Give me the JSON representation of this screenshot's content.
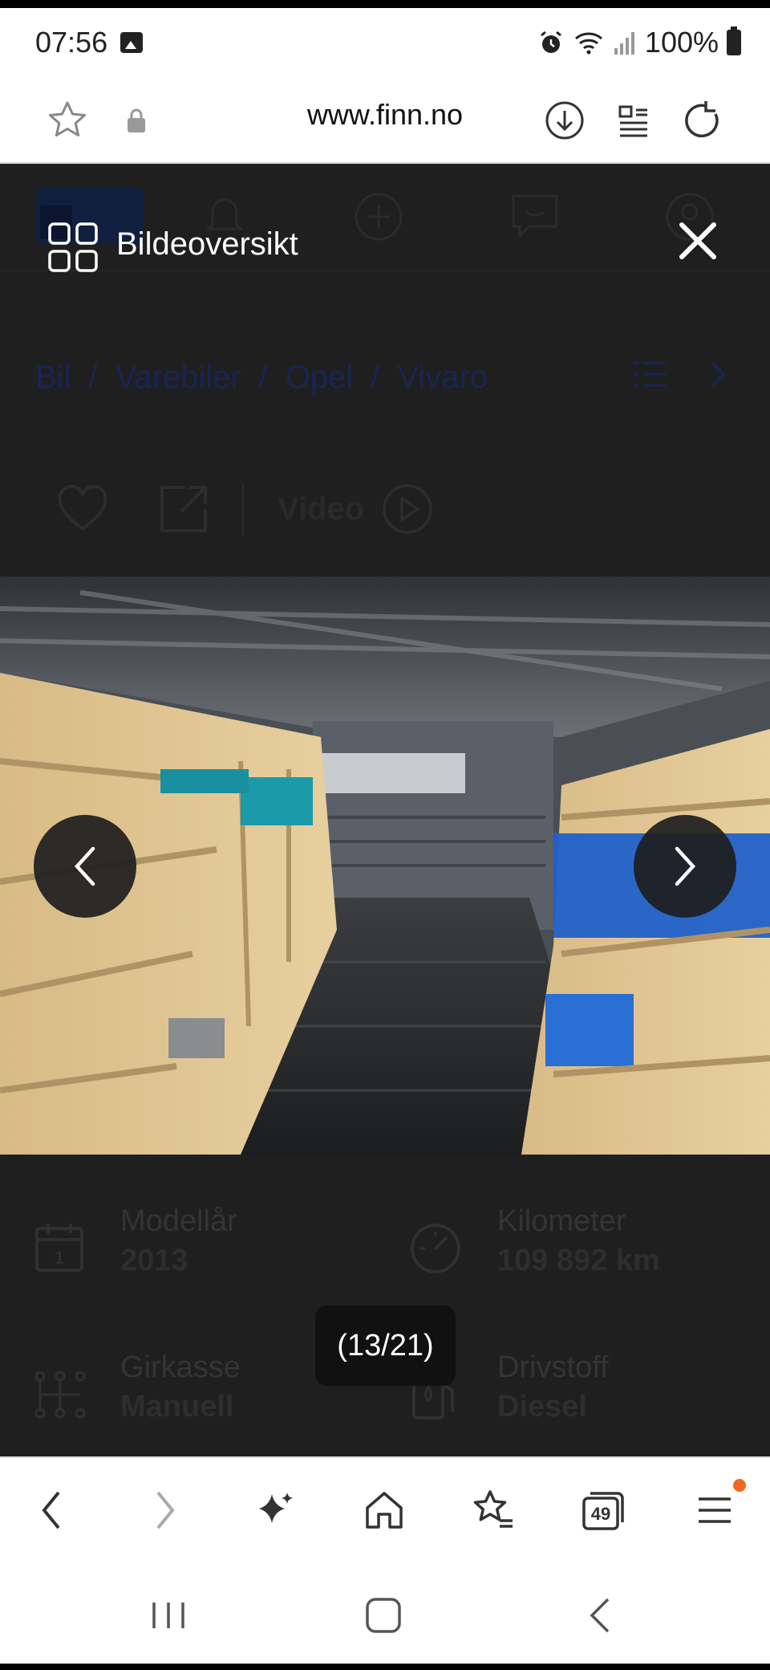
{
  "status_bar": {
    "time": "07:56",
    "battery": "100%"
  },
  "browser": {
    "url": "www.finn.no",
    "tab_count": "49"
  },
  "page": {
    "breadcrumb": [
      "Bil",
      "Varebiler",
      "Opel",
      "Vivaro"
    ],
    "video_label": "Video",
    "specs": [
      {
        "label": "Modellår",
        "value": "2013"
      },
      {
        "label": "Kilometer",
        "value": "109 892 km"
      },
      {
        "label": "Girkasse",
        "value": "Manuell"
      },
      {
        "label": "Drivstoff",
        "value": "Diesel"
      }
    ],
    "calendar_day": "1"
  },
  "gallery": {
    "title": "Bildeoversikt",
    "counter": "(13/21)"
  },
  "colors": {
    "notification_dot": "#f26522",
    "dim_bg": "#1f1f1f"
  }
}
